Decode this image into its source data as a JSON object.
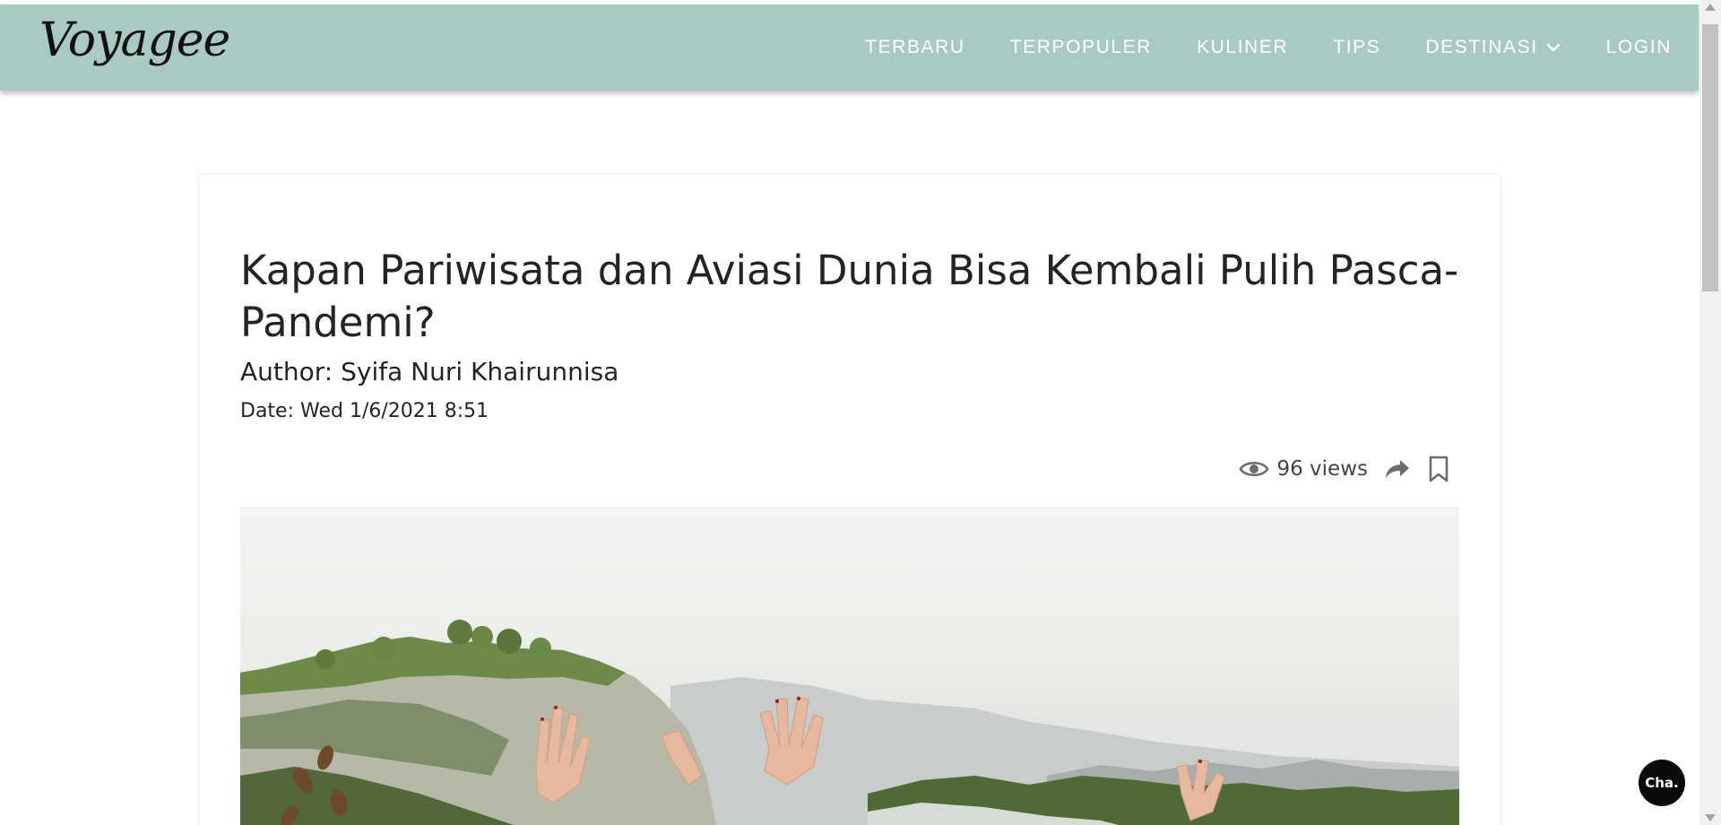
{
  "brand": {
    "name": "Voyagee"
  },
  "nav": {
    "items": [
      {
        "label": "TERBARU"
      },
      {
        "label": "TERPOPULER"
      },
      {
        "label": "KULINER"
      },
      {
        "label": "TIPS"
      },
      {
        "label": "DESTINASI",
        "icon": "chevron-down-icon"
      },
      {
        "label": "LOGIN"
      }
    ]
  },
  "article": {
    "title": "Kapan Pariwisata dan Aviasi Dunia Bisa Kembali Pulih Pasca-Pandemi?",
    "author": "Author: Syifa Nuri Khairunnisa",
    "date": "Date: Wed 1/6/2021 8:51",
    "views": "96 views",
    "icons": [
      "eye-icon",
      "share-icon",
      "bookmark-icon"
    ]
  },
  "chat": {
    "label": "Cha."
  },
  "colors": {
    "navbar": "#a9cac2",
    "nav_text": "#ffffff",
    "text": "#212529",
    "chat_bg": "#0b0b0b"
  }
}
